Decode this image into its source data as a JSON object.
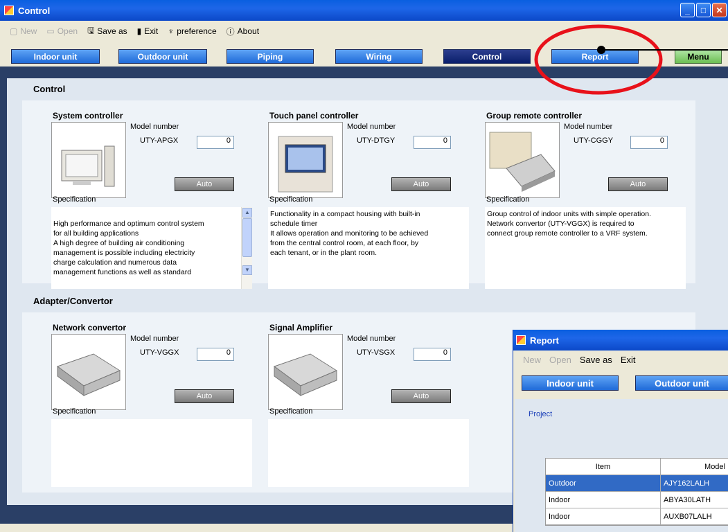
{
  "window": {
    "title": "Control"
  },
  "menubar": {
    "items": [
      {
        "label": "New",
        "icon": "new-file-icon",
        "disabled": true
      },
      {
        "label": "Open",
        "icon": "open-folder-icon",
        "disabled": true
      },
      {
        "label": "Save as",
        "icon": "save-icon",
        "disabled": false
      },
      {
        "label": "Exit",
        "icon": "exit-icon",
        "disabled": false
      },
      {
        "label": "preference",
        "icon": "preference-icon",
        "disabled": false
      },
      {
        "label": "About",
        "icon": "info-icon",
        "disabled": false
      }
    ]
  },
  "nav": {
    "indoor": "Indoor unit",
    "outdoor": "Outdoor unit",
    "piping": "Piping",
    "wiring": "Wiring",
    "control": "Control",
    "report": "Report",
    "menu": "Menu"
  },
  "control_section": {
    "label": "Control",
    "model_label": "Model number",
    "auto_label": "Auto",
    "spec_label": "Specification",
    "cards": [
      {
        "name": "System controller",
        "model": "UTY-APGX",
        "qty": "0",
        "desc": "High performance and optimum control system\nfor all building applications\nA high degree of building air conditioning\nmanagement is possible including electricity\ncharge calculation and numerous data\nmanagement functions as well as standard"
      },
      {
        "name": "Touch panel controller",
        "model": "UTY-DTGY",
        "qty": "0",
        "desc": "Functionality in a compact housing with built-in\nschedule timer\nIt allows operation and monitoring to be achieved\nfrom the central control room, at each floor, by\neach tenant, or in the plant room."
      },
      {
        "name": "Group remote controller",
        "model": "UTY-CGGY",
        "qty": "0",
        "desc": "Group control of indoor units with simple operation.\nNetwork convertor (UTY-VGGX) is required to\nconnect group remote controller to a VRF system."
      }
    ]
  },
  "adapter_section": {
    "label": "Adapter/Convertor",
    "cards": [
      {
        "name": "Network convertor",
        "model": "UTY-VGGX",
        "qty": "0",
        "desc": ""
      },
      {
        "name": "Signal Amplifier",
        "model": "UTY-VSGX",
        "qty": "0",
        "desc": ""
      }
    ]
  },
  "report_window": {
    "title": "Report",
    "menu": [
      {
        "label": "New",
        "disabled": true
      },
      {
        "label": "Open",
        "disabled": true
      },
      {
        "label": "Save as",
        "disabled": false
      },
      {
        "label": "Exit",
        "disabled": false
      }
    ],
    "nav_indoor": "Indoor unit",
    "nav_outdoor": "Outdoor unit",
    "project_label": "Project",
    "grid_headers": [
      "Item",
      "Model"
    ],
    "grid_rows": [
      [
        "Outdoor",
        "AJY162LALH"
      ],
      [
        "Indoor",
        "ABYA30LATH"
      ],
      [
        "Indoor",
        "AUXB07LALH"
      ]
    ]
  },
  "colors": {
    "accent": "#1f6ad8",
    "annotation": "#e8111a"
  }
}
